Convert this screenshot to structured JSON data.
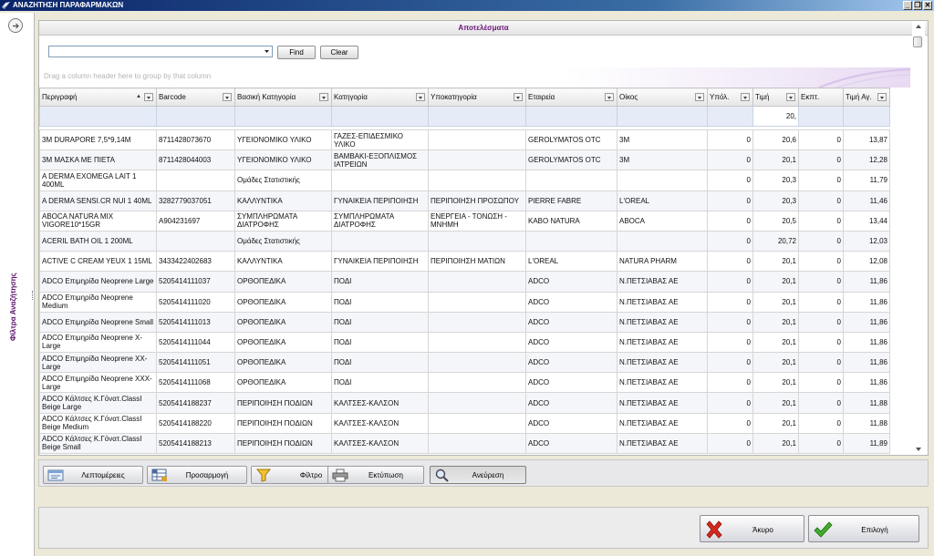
{
  "window": {
    "title": "ΑΝΑΖΗΤΗΣΗ ΠΑΡΑΦΑΡΜΑΚΩΝ",
    "minimize": "_",
    "restore": "❐",
    "close": "✕"
  },
  "left_panel": {
    "label": "Φίλτρα Αναζήτησης"
  },
  "results": {
    "header": "Αποτελέσματα",
    "search": {
      "value": "",
      "placeholder": ""
    },
    "find_label": "Find",
    "clear_label": "Clear",
    "group_hint": "Drag a column header here to group by that column",
    "columns": [
      "Περιγραφή",
      "Barcode",
      "Βασική Κατηγορία",
      "Κατηγορία",
      "Υποκατηγορία",
      "Εταιρεία",
      "Οίκος",
      "Υπόλ.",
      "Τιμή",
      "Εκπτ.",
      "Τιμή Αγ."
    ],
    "filter_value": "20,",
    "rows": [
      [
        "3M DURAPORE 7,5*9,14M",
        "8711428073670",
        "ΥΓΕΙΟΝΟΜΙΚΟ ΥΛΙΚΟ",
        "ΓΑΖΕΣ-ΕΠΙΔΕΣΜΙΚΟ ΥΛΙΚΟ",
        "",
        "GEROLYMATOS OTC",
        "3M",
        "0",
        "20,6",
        "0",
        "13,87"
      ],
      [
        "3M ΜΑΣΚΑ ΜΕ ΠΙΕΤΑ",
        "8711428044003",
        "ΥΓΕΙΟΝΟΜΙΚΟ ΥΛΙΚΟ",
        "ΒΑΜΒΑΚΙ-ΕΞΟΠΛΙΣΜΟΣ ΙΑΤΡΕΙΩΝ",
        "",
        "GEROLYMATOS OTC",
        "3M",
        "0",
        "20,1",
        "0",
        "12,28"
      ],
      [
        "A DERMA EXOMEGA LAIT 1 400ML",
        "",
        "Ομάδες Στατιστικής",
        "",
        "",
        "",
        "",
        "0",
        "20,3",
        "0",
        "11,79"
      ],
      [
        "A DERMA SENSI.CR NUI 1 40ML",
        "3282779037051",
        "ΚΑΛΛΥΝΤΙΚΑ",
        "ΓΥΝΑΙΚΕΙΑ ΠΕΡΙΠΟΙΗΣΗ",
        "ΠΕΡΙΠΟΙΗΣΗ ΠΡΟΣΩΠΟΥ",
        "PIERRE FABRE",
        "L'OREAL",
        "0",
        "20,3",
        "0",
        "11,46"
      ],
      [
        "ABOCA NATURA MIX VIGORE10*15GR",
        "A904231697",
        "ΣΥΜΠΛΗΡΩΜΑΤΑ ΔΙΑΤΡΟΦΗΣ",
        "ΣΥΜΠΛΗΡΩΜΑΤΑ ΔΙΑΤΡΟΦΗΣ",
        "ΕΝΕΡΓΕΙΑ - ΤΟΝΩΣΗ - ΜΝΗΜΗ",
        "KABO NATURA",
        "ABOCA",
        "0",
        "20,5",
        "0",
        "13,44"
      ],
      [
        "ACERIL BATH OIL 1 200ML",
        "",
        "Ομάδες Στατιστικής",
        "",
        "",
        "",
        "",
        "0",
        "20,72",
        "0",
        "12,03"
      ],
      [
        "ACTIVE C CREAM YEUX 1 15ML",
        "3433422402683",
        "ΚΑΛΛΥΝΤΙΚΑ",
        "ΓΥΝΑΙΚΕΙΑ ΠΕΡΙΠΟΙΗΣΗ",
        "ΠΕΡΙΠΟΙΗΣΗ ΜΑΤΙΩΝ",
        "L'OREAL",
        "NATURA PHARM",
        "0",
        "20,1",
        "0",
        "12,08"
      ],
      [
        "ADCO Επιμηρίδα Neoprene Large",
        "5205414111037",
        "ΟΡΘΟΠΕΔΙΚΑ",
        "ΠΟΔΙ",
        "",
        "ADCO",
        "Ν.ΠΕΤΣΙΑΒΑΣ ΑΕ",
        "0",
        "20,1",
        "0",
        "11,86"
      ],
      [
        "ADCO Επιμηρίδα Neoprene Medium",
        "5205414111020",
        "ΟΡΘΟΠΕΔΙΚΑ",
        "ΠΟΔΙ",
        "",
        "ADCO",
        "Ν.ΠΕΤΣΙΑΒΑΣ ΑΕ",
        "0",
        "20,1",
        "0",
        "11,86"
      ],
      [
        "ADCO Επιμηρίδα Neoprene Small",
        "5205414111013",
        "ΟΡΘΟΠΕΔΙΚΑ",
        "ΠΟΔΙ",
        "",
        "ADCO",
        "Ν.ΠΕΤΣΙΑΒΑΣ ΑΕ",
        "0",
        "20,1",
        "0",
        "11,86"
      ],
      [
        "ADCO Επιμηρίδα Neoprene X-Large",
        "5205414111044",
        "ΟΡΘΟΠΕΔΙΚΑ",
        "ΠΟΔΙ",
        "",
        "ADCO",
        "Ν.ΠΕΤΣΙΑΒΑΣ ΑΕ",
        "0",
        "20,1",
        "0",
        "11,86"
      ],
      [
        "ADCO Επιμηρίδα Neoprene XX-Large",
        "5205414111051",
        "ΟΡΘΟΠΕΔΙΚΑ",
        "ΠΟΔΙ",
        "",
        "ADCO",
        "Ν.ΠΕΤΣΙΑΒΑΣ ΑΕ",
        "0",
        "20,1",
        "0",
        "11,86"
      ],
      [
        "ADCO Επιμηρίδα Neoprene XXX-Large",
        "5205414111068",
        "ΟΡΘΟΠΕΔΙΚΑ",
        "ΠΟΔΙ",
        "",
        "ADCO",
        "Ν.ΠΕΤΣΙΑΒΑΣ ΑΕ",
        "0",
        "20,1",
        "0",
        "11,86"
      ],
      [
        "ADCO Κάλτσες Κ.Γόνατ.ClassI Beige Large",
        "5205414188237",
        "ΠΕΡΙΠΟΙΗΣΗ ΠΟΔΙΩΝ",
        "ΚΑΛΤΣΕΣ-ΚΑΛΣΟΝ",
        "",
        "ADCO",
        "Ν.ΠΕΤΣΙΑΒΑΣ ΑΕ",
        "0",
        "20,1",
        "0",
        "11,88"
      ],
      [
        "ADCO Κάλτσες Κ.Γόνατ.ClassI Beige Medium",
        "5205414188220",
        "ΠΕΡΙΠΟΙΗΣΗ ΠΟΔΙΩΝ",
        "ΚΑΛΤΣΕΣ-ΚΑΛΣΟΝ",
        "",
        "ADCO",
        "Ν.ΠΕΤΣΙΑΒΑΣ ΑΕ",
        "0",
        "20,1",
        "0",
        "11,88"
      ],
      [
        "ADCO Κάλτσες Κ.Γόνατ.ClassI Beige Small",
        "5205414188213",
        "ΠΕΡΙΠΟΙΗΣΗ ΠΟΔΙΩΝ",
        "ΚΑΛΤΣΕΣ-ΚΑΛΣΟΝ",
        "",
        "ADCO",
        "Ν.ΠΕΤΣΙΑΒΑΣ ΑΕ",
        "0",
        "20,1",
        "0",
        "11,89"
      ]
    ]
  },
  "actions": {
    "details": "Λεπτομέρειες",
    "customize": "Προσαρμογή",
    "filter": "Φίλτρο",
    "print": "Εκτύπωση",
    "search": "Ανεύρεση"
  },
  "footer": {
    "cancel": "Άκυρο",
    "select": "Επιλογή"
  },
  "colors": {
    "header_text": "#6a1478",
    "filter_row": "#e6ecf7",
    "title_bar": "#0a246a"
  }
}
